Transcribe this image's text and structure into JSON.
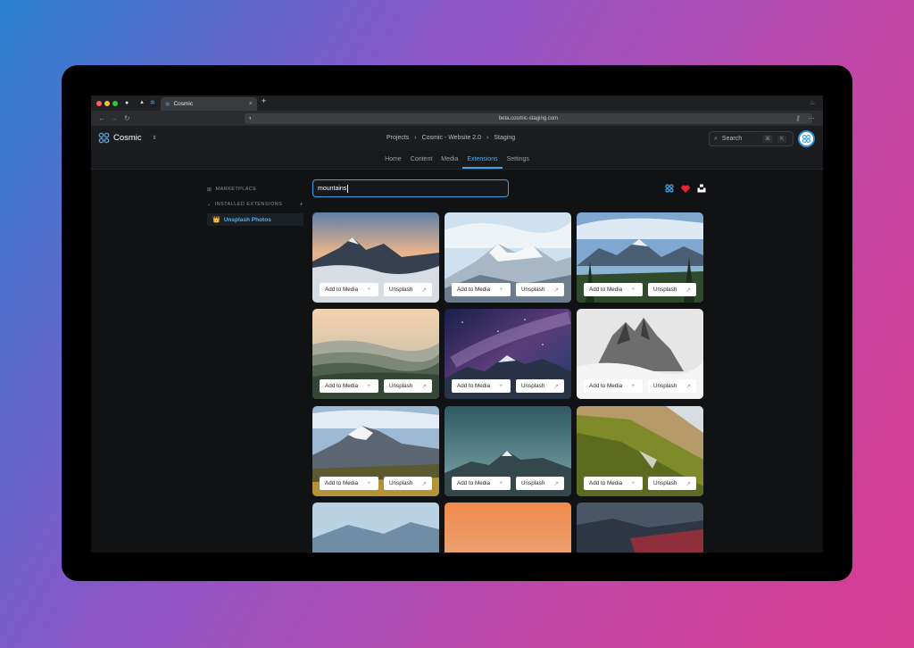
{
  "browser": {
    "tab_title": "Cosmic",
    "tab_close": "×",
    "new_tab": "+",
    "url": "beta.cosmic-staging.com"
  },
  "app": {
    "brand": "Cosmic",
    "breadcrumb": [
      "Projects",
      "›",
      "Cosmic - Website 2.0",
      "›",
      "Staging"
    ],
    "search_label": "Search",
    "search_kbd1": "⌘",
    "search_kbd2": "K",
    "nav": [
      "Home",
      "Content",
      "Media",
      "Extensions",
      "Settings"
    ],
    "active_nav": "Extensions"
  },
  "sidebar": {
    "marketplace": "MARKETPLACE",
    "installed": "INSTALLED EXTENSIONS",
    "installed_add": "+",
    "active_item": "Unsplash Photos"
  },
  "search": {
    "value": "mountains"
  },
  "card_labels": {
    "add": "Add to Media",
    "add_icon": "+",
    "source": "Unsplash",
    "source_icon": "↗"
  },
  "colors": {
    "accent": "#3aa5ec",
    "heart": "#e5253a"
  },
  "photos": [
    {
      "name": "sunset-peak-clouds"
    },
    {
      "name": "snowy-range"
    },
    {
      "name": "lake-valley-peaks"
    },
    {
      "name": "misty-hills-pastel"
    },
    {
      "name": "milky-way-peaks"
    },
    {
      "name": "foggy-rock-spires"
    },
    {
      "name": "snow-peak-meadow"
    },
    {
      "name": "teal-sky-peak"
    },
    {
      "name": "grassy-slope"
    },
    {
      "name": "blue-ridge"
    },
    {
      "name": "orange-sky"
    },
    {
      "name": "dusk-red-ridge"
    }
  ]
}
